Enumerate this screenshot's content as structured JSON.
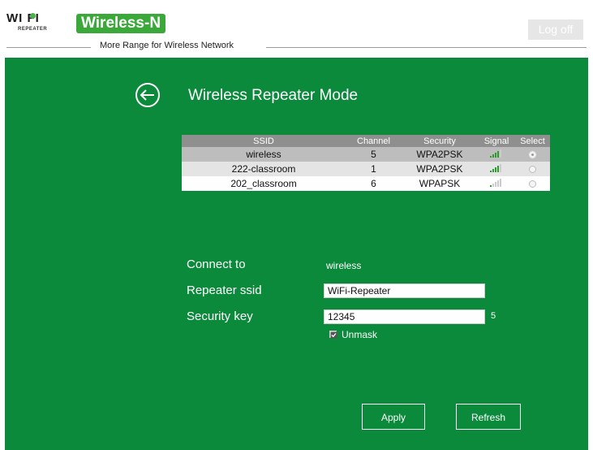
{
  "header": {
    "logo_word": "WI FI",
    "logo_sub": "REPEATER",
    "brand": "Wireless-N",
    "tagline": "More Range for Wireless Network",
    "logoff_label": "Log off"
  },
  "page": {
    "title": "Wireless Repeater Mode"
  },
  "table": {
    "headers": [
      "SSID",
      "Channel",
      "Security",
      "Signal",
      "Select"
    ],
    "rows": [
      {
        "ssid": "wireless",
        "channel": "5",
        "security": "WPA2PSK",
        "signal_level": 4,
        "selected": true
      },
      {
        "ssid": "222-classroom",
        "channel": "1",
        "security": "WPA2PSK",
        "signal_level": 4,
        "selected": false
      },
      {
        "ssid": "202_classroom",
        "channel": "6",
        "security": "WPAPSK",
        "signal_level": 1,
        "selected": false
      }
    ]
  },
  "form": {
    "connect_label": "Connect to",
    "connect_value": "wireless",
    "ssid_label": "Repeater ssid",
    "ssid_value": "WiFi-Repeater",
    "key_label": "Security key",
    "key_value": "12345",
    "key_length": "5",
    "unmask_label": "Unmask",
    "unmask_checked": true
  },
  "buttons": {
    "apply": "Apply",
    "refresh": "Refresh"
  },
  "colors": {
    "brand_green": "#3aa93a",
    "main_bg": "#0b8a3c",
    "signal_on": "#2e9b2e",
    "signal_off": "#cccccc"
  }
}
